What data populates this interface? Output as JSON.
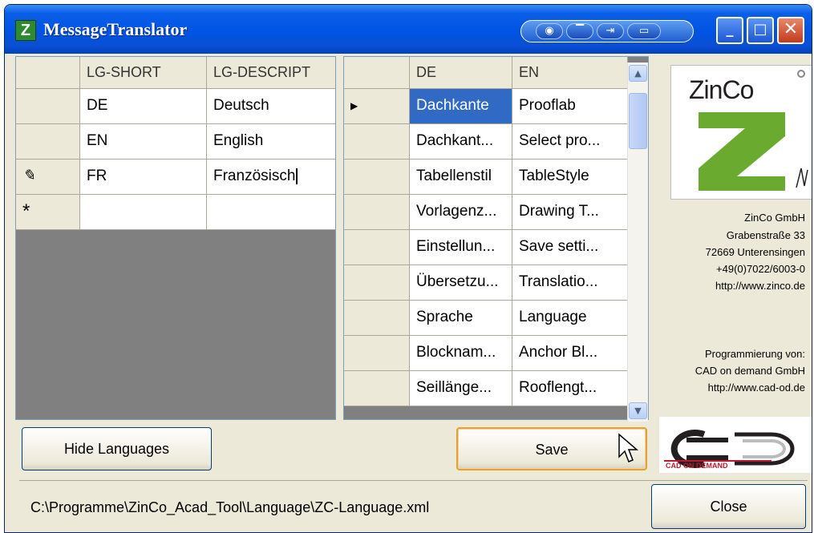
{
  "window": {
    "title": "MessageTranslator",
    "app_icon_letter": "Z"
  },
  "left_grid": {
    "columns": [
      "LG-SHORT",
      "LG-DESCRIPT"
    ],
    "rows": [
      {
        "indicator": "",
        "short": "DE",
        "descript": "Deutsch"
      },
      {
        "indicator": "✎",
        "short": "EN",
        "descript": "English"
      },
      {
        "indicator": "✎",
        "short": "FR",
        "descript": "Französisch"
      },
      {
        "indicator": "*",
        "short": "",
        "descript": ""
      }
    ]
  },
  "right_grid": {
    "columns": [
      "DE",
      "EN"
    ],
    "rows": [
      {
        "de": "Dachkante",
        "en": "Prooflab"
      },
      {
        "de": "Dachkant...",
        "en": "Select pro..."
      },
      {
        "de": "Tabellenstil",
        "en": "TableStyle"
      },
      {
        "de": "Vorlagenz...",
        "en": "Drawing T..."
      },
      {
        "de": "Einstellun...",
        "en": "Save setti..."
      },
      {
        "de": "Übersetzu...",
        "en": "Translatio..."
      },
      {
        "de": "Sprache",
        "en": "Language"
      },
      {
        "de": "Blocknam...",
        "en": "Anchor Bl..."
      },
      {
        "de": "Seillänge...",
        "en": "Rooflengt..."
      }
    ]
  },
  "company": {
    "logo_text": "ZinCo",
    "name": "ZinCo GmbH",
    "street": "Grabenstraße 33",
    "city": "72669 Unterensingen",
    "phone": "+49(0)7022/6003-0",
    "web": "http://www.zinco.de",
    "programmed_by": "Programmierung von:",
    "dev_name": "CAD on demand GmbH",
    "dev_web": "http://www.cad-od.de",
    "cad_logo_sub": "CAD ON DEMAND"
  },
  "buttons": {
    "hide_languages": "Hide Languages",
    "save": "Save",
    "close": "Close"
  },
  "status": {
    "file_path": "C:\\Programme\\ZinCo_Acad_Tool\\Language\\ZC-Language.xml"
  },
  "colors": {
    "title_bar": "#0054e3",
    "selection": "#316ac5",
    "zinco_green": "#6aaa2f",
    "cad_red": "#c2172f"
  }
}
